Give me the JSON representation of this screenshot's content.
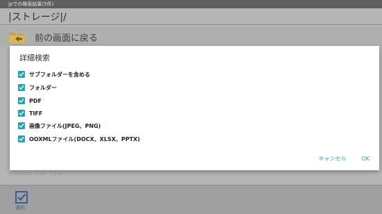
{
  "status": {
    "text": "jpでの検索結果(5件)"
  },
  "header": {
    "path": "|ストレージ|/"
  },
  "back": {
    "label": "前の画面に戻る"
  },
  "background_row": {
    "text": "2016/06/01 10:00 · 3.5 KB"
  },
  "dialog": {
    "title": "詳細検索",
    "options": [
      {
        "label": "サブフォルダーを含める",
        "checked": true
      },
      {
        "label": "フォルダー",
        "checked": true
      },
      {
        "label": "PDF",
        "checked": true
      },
      {
        "label": "TIFF",
        "checked": true
      },
      {
        "label": "画像ファイル(JPEG、PNG)",
        "checked": true
      },
      {
        "label": "OOXMLファイル(DOCX、XLSX、PPTX)",
        "checked": true
      }
    ],
    "cancel_label": "キャンセル",
    "ok_label": "OK"
  },
  "bottom_bar": {
    "select_label": "選択"
  },
  "colors": {
    "accent": "#2aa1b3",
    "dim_background": "#b5b5b5"
  },
  "icons": {
    "back": "folder-back-icon",
    "select": "checkbox-select-icon",
    "option": "check-icon"
  }
}
